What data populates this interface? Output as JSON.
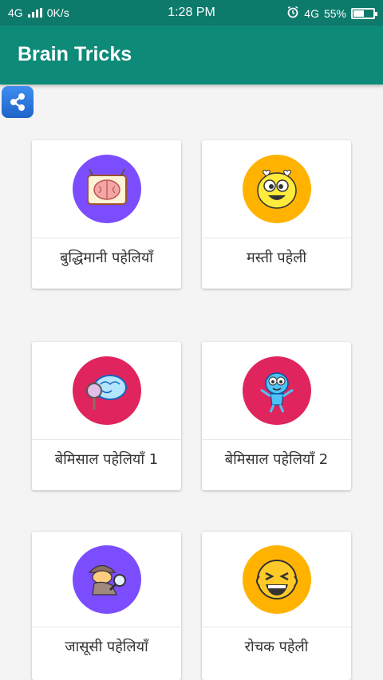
{
  "status_bar": {
    "network": "4G",
    "speed": "0K/s",
    "time": "1:28 PM",
    "network_right": "4G",
    "battery_percent": "55%",
    "battery_level": 0.55
  },
  "app": {
    "title": "Brain Tricks"
  },
  "share_icon": "share-icon",
  "cards": [
    {
      "label": "बुद्धिमानी पहेलियाँ",
      "icon": "brain-icon",
      "color": "#7c4dff"
    },
    {
      "label": "मस्ती पहेली",
      "icon": "smiley-icon",
      "color": "#ffb300"
    },
    {
      "label": "बेमिसाल पहेलियाँ 1",
      "icon": "brain-magnifier-icon",
      "color": "#e0245e"
    },
    {
      "label": "बेमिसाल पहेलियाँ 2",
      "icon": "cartoon-icon",
      "color": "#e0245e"
    },
    {
      "label": "जासूसी पहेलियाँ",
      "icon": "detective-icon",
      "color": "#7c4dff"
    },
    {
      "label": "रोचक पहेली",
      "icon": "laughing-icon",
      "color": "#ffb300"
    }
  ]
}
